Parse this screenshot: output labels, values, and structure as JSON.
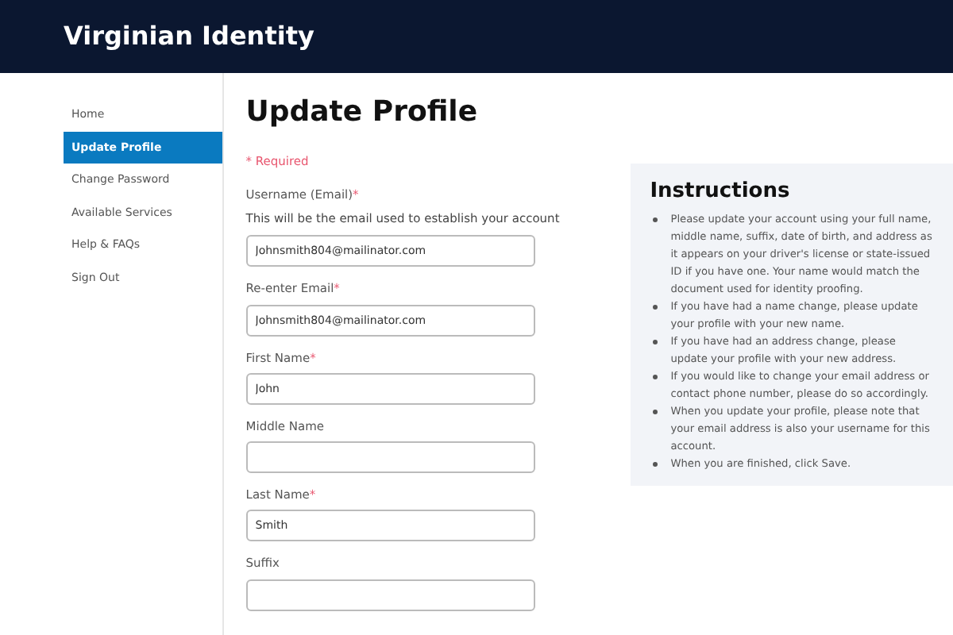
{
  "header": {
    "title": "Virginian Identity"
  },
  "sidebar": {
    "items": [
      {
        "label": "Home",
        "selected": false
      },
      {
        "label": "Update Profile",
        "selected": true
      },
      {
        "label": "Change Password",
        "selected": false
      },
      {
        "label": "Available Services",
        "selected": false
      },
      {
        "label": "Help & FAQs",
        "selected": false
      },
      {
        "label": "Sign Out",
        "selected": false
      }
    ]
  },
  "page_title": "Update Profile",
  "required_note": "* Required",
  "fields": [
    {
      "label": "Username (Email)",
      "mark": "*",
      "hint": "This will be the email used to establish your account",
      "value": "Johnsmith804@mailinator.com"
    },
    {
      "label": "Re-enter Email",
      "mark": "*",
      "value": "Johnsmith804@mailinator.com"
    },
    {
      "label": "First Name",
      "mark": "*",
      "value": "John"
    },
    {
      "label": "Middle Name"
    },
    {
      "label": "Last Name",
      "mark": "*",
      "value": "Smith"
    },
    {
      "label": "Suffix"
    }
  ],
  "instructions": {
    "title": "Instructions",
    "items": [
      "Please update your account using your full name, middle name, suffix, date of birth, and address as it appears on your driver's license or state-issued ID if you have one. Your name would match the document used for identity proofing.",
      "If you have had a name change, please update your profile with your new name.",
      "If you have had an address change, please update your profile with your new address.",
      "If you would like to change your email address or contact phone number, please do so accordingly.",
      "When you update your profile, please note that your email address is also your username for this account.",
      "When you are finished, click Save."
    ]
  }
}
